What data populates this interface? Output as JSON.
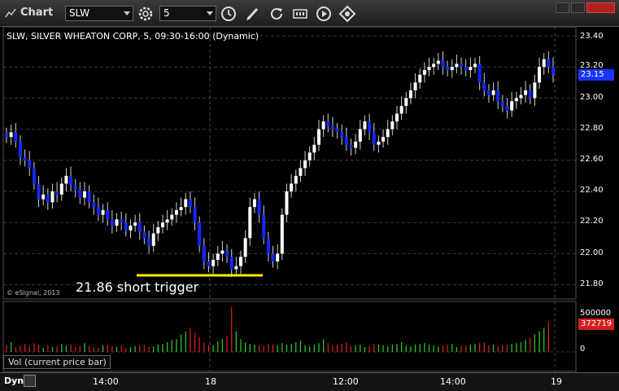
{
  "app": {
    "title": "Chart",
    "icon": "chart-app-icon"
  },
  "toolbar": {
    "symbol": "SLW",
    "interval": "5",
    "buttons": [
      "settings-gear-icon",
      "clock-icon",
      "pencil-icon",
      "refresh-icon",
      "stats-icon",
      "play-icon",
      "navigate-icon"
    ]
  },
  "window_controls": [
    "minimize-icon",
    "maximize-icon",
    "close-icon"
  ],
  "chart_header": "SLW, SILVER WHEATON CORP, 5, 09:30-16:00 (Dynamic)",
  "copyright": "© eSignal, 2013",
  "annotation": "21.86 short trigger",
  "price_axis": {
    "labels": [
      "23.40",
      "23.20",
      "23.00",
      "22.80",
      "22.60",
      "22.40",
      "22.20",
      "22.00",
      "21.80"
    ],
    "current": "23.15"
  },
  "volume_axis": {
    "labels": [
      "500000",
      "0"
    ],
    "current": "372719"
  },
  "volume_panel_label": "Vol (current price bar)",
  "bottom": {
    "dyn": "Dyn",
    "time_labels": [
      "14:00",
      "18",
      "12:00",
      "14:00",
      "19"
    ]
  },
  "colors": {
    "up_bar": "#ffffff",
    "down_bar": "#1428ff",
    "vol_up": "#27c627",
    "vol_down": "#d81e1e",
    "trigger_line": "#ffef00",
    "price_tag": "#1a35ff"
  },
  "chart_data": {
    "type": "candlestick",
    "title": "SLW, SILVER WHEATON CORP, 5, 09:30-16:00 (Dynamic)",
    "ylim": [
      21.75,
      23.45
    ],
    "y_ticks": [
      21.8,
      22.0,
      22.2,
      22.4,
      22.6,
      22.8,
      23.0,
      23.2,
      23.4
    ],
    "x_ticks": [
      "14:00",
      "18",
      "12:00",
      "14:00",
      "19"
    ],
    "trigger_level": 21.86,
    "close": [
      22.75,
      22.78,
      22.72,
      22.62,
      22.6,
      22.55,
      22.45,
      22.35,
      22.38,
      22.33,
      22.4,
      22.38,
      22.45,
      22.5,
      22.44,
      22.41,
      22.36,
      22.4,
      22.33,
      22.3,
      22.25,
      22.28,
      22.22,
      22.18,
      22.22,
      22.2,
      22.15,
      22.18,
      22.2,
      22.14,
      22.1,
      22.05,
      22.13,
      22.17,
      22.2,
      22.22,
      22.25,
      22.28,
      22.3,
      22.35,
      22.3,
      22.2,
      22.05,
      21.95,
      21.92,
      21.96,
      22.0,
      22.02,
      21.98,
      21.9,
      21.92,
      21.98,
      22.1,
      22.3,
      22.35,
      22.25,
      22.1,
      22.0,
      21.95,
      22.0,
      22.25,
      22.4,
      22.45,
      22.5,
      22.55,
      22.6,
      22.65,
      22.7,
      22.8,
      22.85,
      22.82,
      22.8,
      22.78,
      22.75,
      22.7,
      22.68,
      22.72,
      22.8,
      22.85,
      22.78,
      22.7,
      22.72,
      22.75,
      22.8,
      22.85,
      22.9,
      22.95,
      23.0,
      23.05,
      23.1,
      23.15,
      23.18,
      23.2,
      23.22,
      23.24,
      23.2,
      23.18,
      23.2,
      23.22,
      23.2,
      23.18,
      23.2,
      23.22,
      23.1,
      23.05,
      23.02,
      23.05,
      22.98,
      22.95,
      22.92,
      22.98,
      23.0,
      23.02,
      23.05,
      23.0,
      23.1,
      23.2,
      23.25,
      23.2,
      23.15
    ],
    "volume": [
      90000,
      120000,
      60000,
      80000,
      100000,
      70000,
      110000,
      90000,
      50000,
      80000,
      60000,
      70000,
      100000,
      80000,
      90000,
      60000,
      80000,
      110000,
      70000,
      60000,
      50000,
      80000,
      90000,
      70000,
      60000,
      80000,
      50000,
      60000,
      70000,
      80000,
      90000,
      60000,
      70000,
      90000,
      100000,
      120000,
      150000,
      160000,
      220000,
      260000,
      300000,
      240000,
      180000,
      120000,
      90000,
      80000,
      130000,
      160000,
      200000,
      560000,
      260000,
      160000,
      120000,
      100000,
      90000,
      80000,
      70000,
      100000,
      90000,
      80000,
      110000,
      90000,
      100000,
      120000,
      140000,
      80000,
      70000,
      90000,
      110000,
      160000,
      110000,
      80000,
      90000,
      100000,
      120000,
      70000,
      80000,
      90000,
      60000,
      70000,
      100000,
      90000,
      80000,
      70000,
      90000,
      100000,
      120000,
      80000,
      70000,
      90000,
      100000,
      110000,
      90000,
      80000,
      70000,
      80000,
      90000,
      100000,
      60000,
      70000,
      80000,
      90000,
      100000,
      110000,
      120000,
      80000,
      90000,
      70000,
      80000,
      90000,
      100000,
      110000,
      120000,
      150000,
      180000,
      220000,
      260000,
      300000,
      372719
    ]
  }
}
